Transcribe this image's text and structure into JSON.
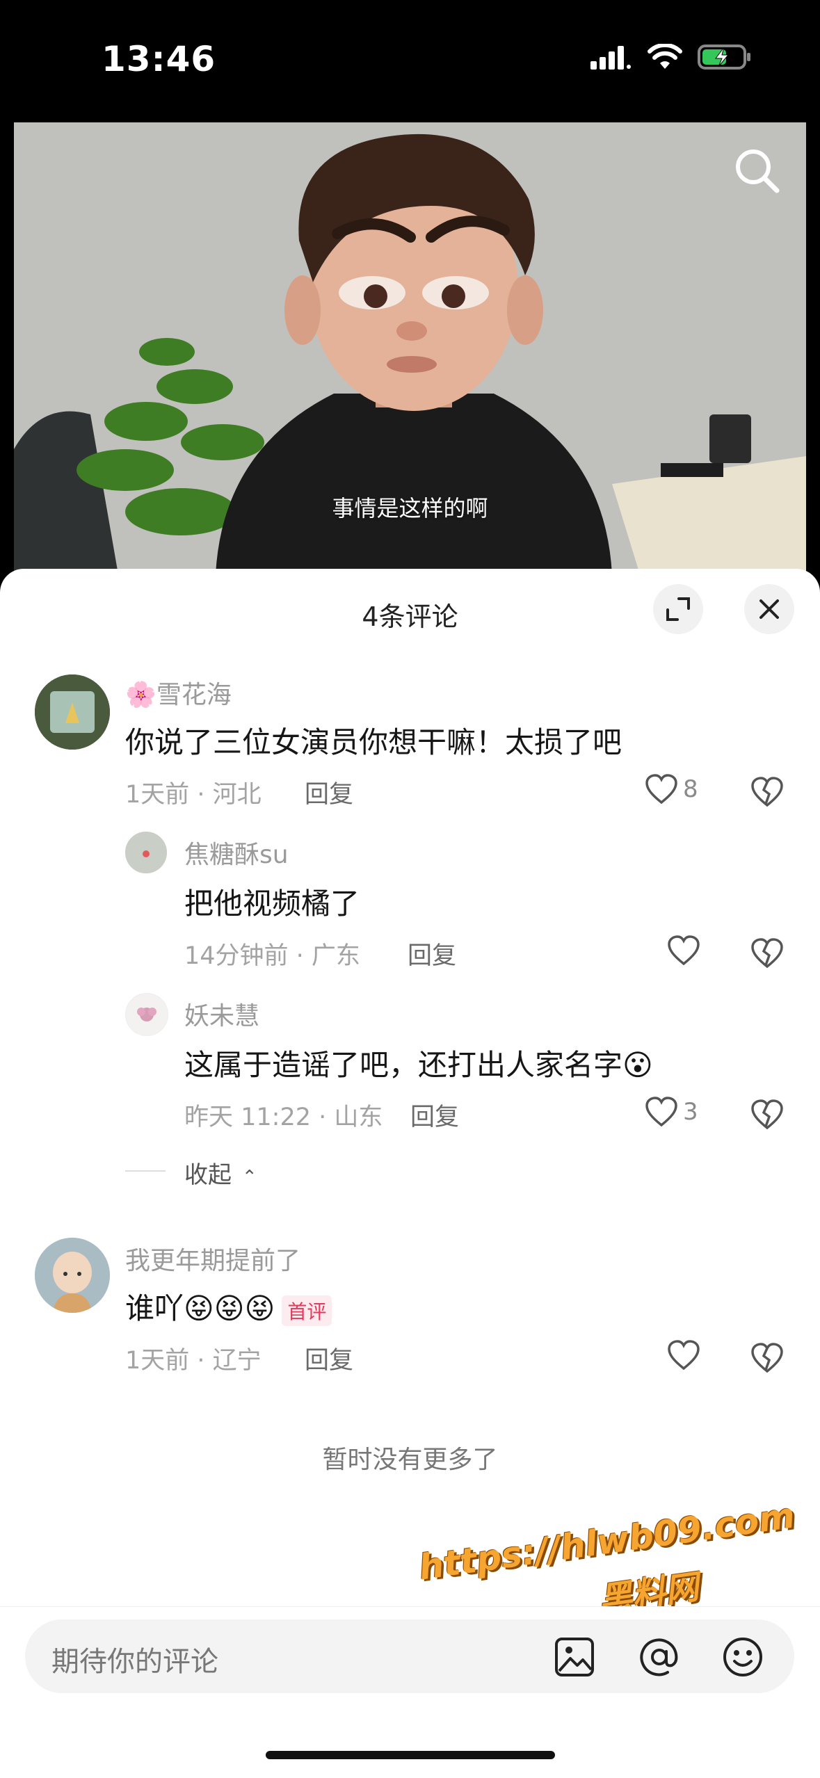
{
  "status_bar": {
    "time": "13:46"
  },
  "video": {
    "subtitle": "事情是这样的啊"
  },
  "comments_sheet": {
    "title": "4条评论",
    "comments": [
      {
        "name": "🌸雪花海",
        "text": "你说了三位女演员你想干嘛！太损了吧",
        "meta": "1天前 · 河北",
        "reply": "回复",
        "likes": "8"
      },
      {
        "name": "焦糖酥su",
        "text": "把他视频橘了",
        "meta": "14分钟前 · 广东",
        "reply": "回复",
        "likes": ""
      },
      {
        "name": "妖未慧",
        "text": "这属于造谣了吧，还打出人家名字😮",
        "meta": "昨天 11:22 · 山东",
        "reply": "回复",
        "likes": "3"
      },
      {
        "name": "我更年期提前了",
        "text": "谁吖😝😝😝",
        "badge": "首评",
        "meta": "1天前 · 辽宁",
        "reply": "回复",
        "likes": ""
      }
    ],
    "collapse": "收起",
    "no_more": "暂时没有更多了"
  },
  "watermark": {
    "line1": "https://hlwb09.com",
    "line2": "黑料网"
  },
  "input": {
    "placeholder": "期待你的评论"
  },
  "colors": {
    "accent": "#e4395c",
    "sheet_bg": "#ffffff",
    "watermark": "#f6a531"
  }
}
